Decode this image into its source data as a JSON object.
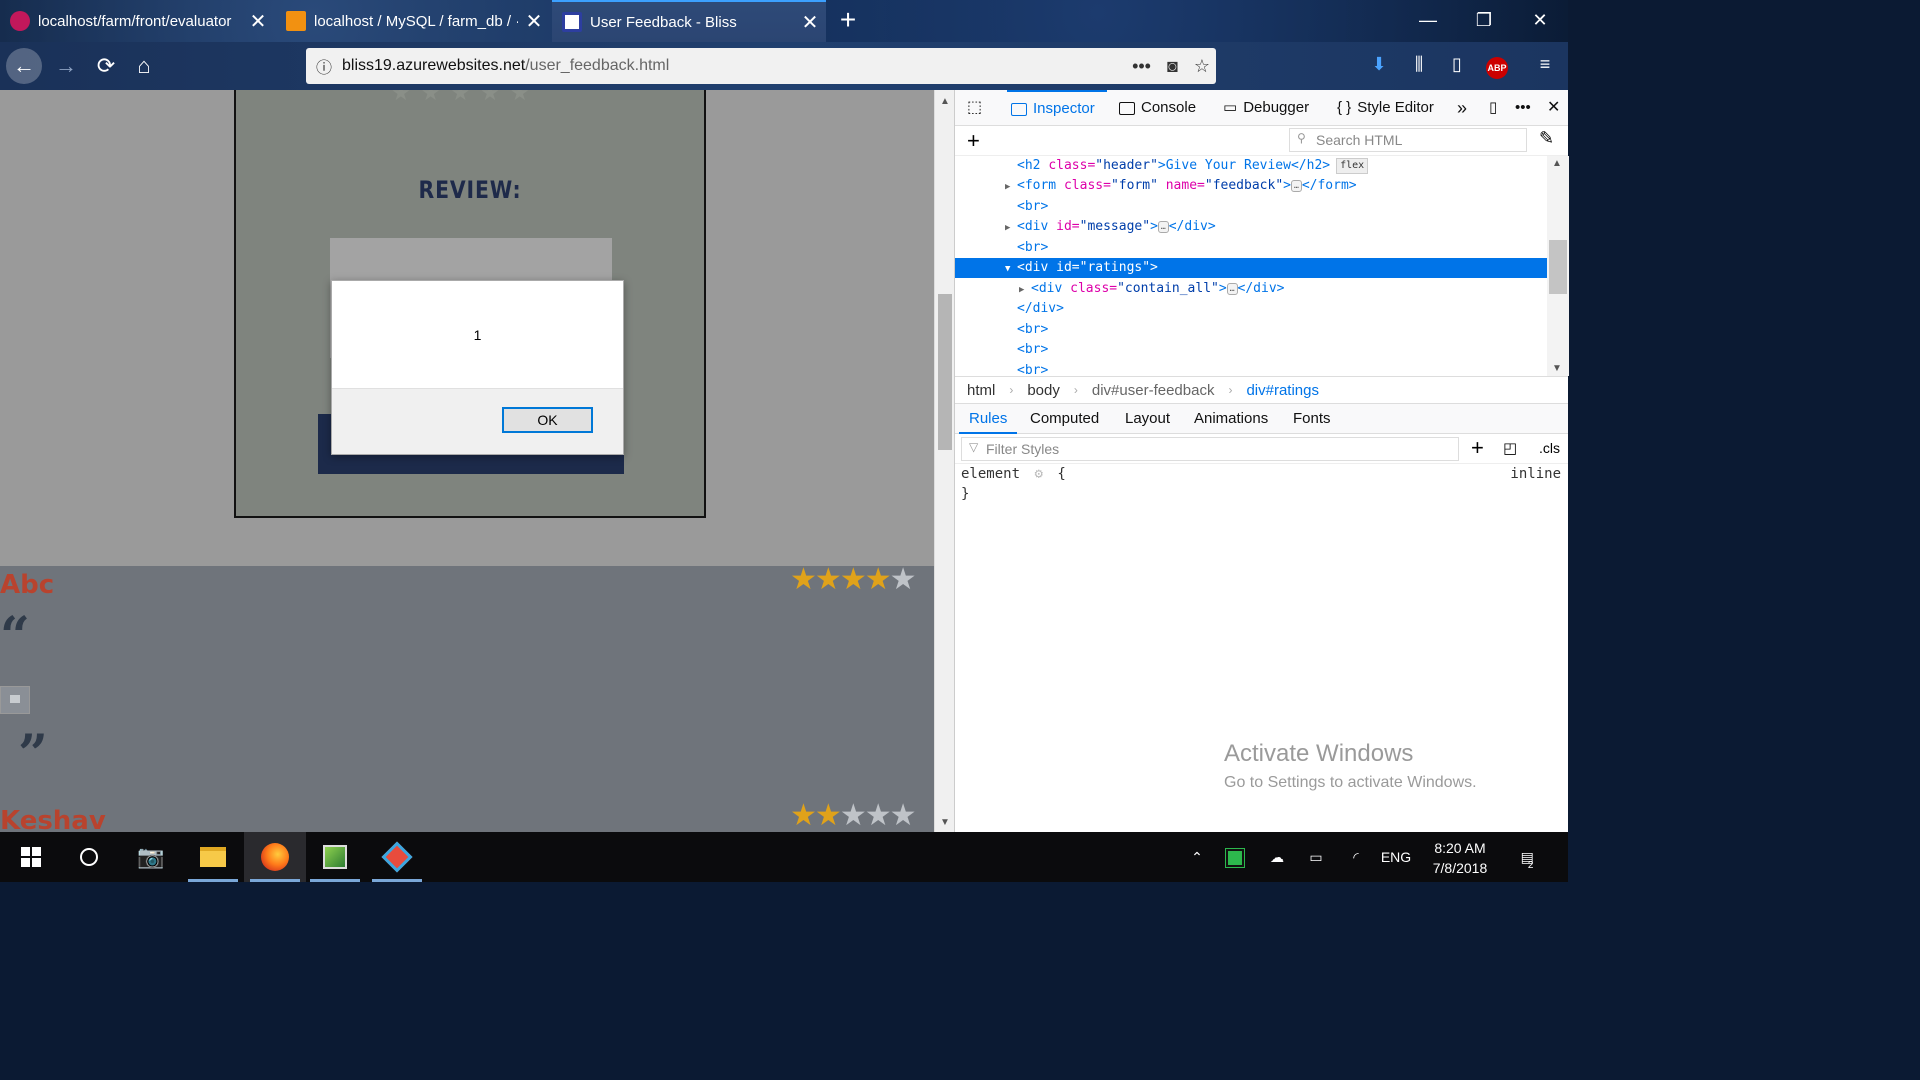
{
  "tabs": [
    {
      "title": "localhost/farm/front/evaluator",
      "active": false,
      "favicon_color": "#c2185b"
    },
    {
      "title": "localhost / MySQL / farm_db / ·",
      "active": false,
      "favicon_color": "#f29111"
    },
    {
      "title": "User Feedback - Bliss",
      "active": true,
      "favicon_color": "#2d3ea0"
    }
  ],
  "window_controls": {
    "minimize": "—",
    "maximize": "❐",
    "close": "✕"
  },
  "url": {
    "host": "bliss19.azurewebsites.net",
    "path": "/user_feedback.html"
  },
  "page": {
    "review_title": "REVIEW:",
    "alert_message": "1",
    "ok_label": "OK",
    "feedback": [
      {
        "name": "Abc",
        "rating": 4,
        "max": 5
      },
      {
        "name": "Keshav",
        "rating": 2,
        "max": 5
      }
    ]
  },
  "devtools": {
    "tabs": [
      "Inspector",
      "Console",
      "Debugger",
      "Style Editor"
    ],
    "selected_tab": "Inspector",
    "search_placeholder": "Search HTML",
    "markup": {
      "l1_tag_open": "<h2 ",
      "l1_attr": "class=",
      "l1_val": "\"header\"",
      "l1_text": ">Give Your Review</h2>",
      "l1_badge": "flex",
      "l2_open": "<form ",
      "l2_attr1": "class=",
      "l2_val1": "\"form\"",
      "l2_attr2": " name=",
      "l2_val2": "\"feedback\"",
      "l2_close": "</form>",
      "br": "<br>",
      "l4_open": "<div ",
      "l4_attr": "id=",
      "l4_val": "\"message\"",
      "l4_close": "</div>",
      "l6_text": "<div id=\"ratings\">",
      "l7_open": "<div ",
      "l7_attr": "class=",
      "l7_val": "\"contain_all\"",
      "l7_close": "</div>",
      "l8_text": "</div>"
    },
    "breadcrumbs": [
      "html",
      "body",
      "div#user-feedback",
      "div#ratings"
    ],
    "side_tabs": [
      "Rules",
      "Computed",
      "Layout",
      "Animations",
      "Fonts"
    ],
    "filter_placeholder": "Filter Styles",
    "cls_label": ".cls",
    "rule_selector": "element",
    "rule_open": "{",
    "rule_close": "}",
    "rule_source": "inline"
  },
  "watermark": {
    "title": "Activate Windows",
    "subtitle": "Go to Settings to activate Windows."
  },
  "taskbar": {
    "lang": "ENG",
    "time": "8:20 AM",
    "date": "7/8/2018",
    "notifications": "2"
  }
}
